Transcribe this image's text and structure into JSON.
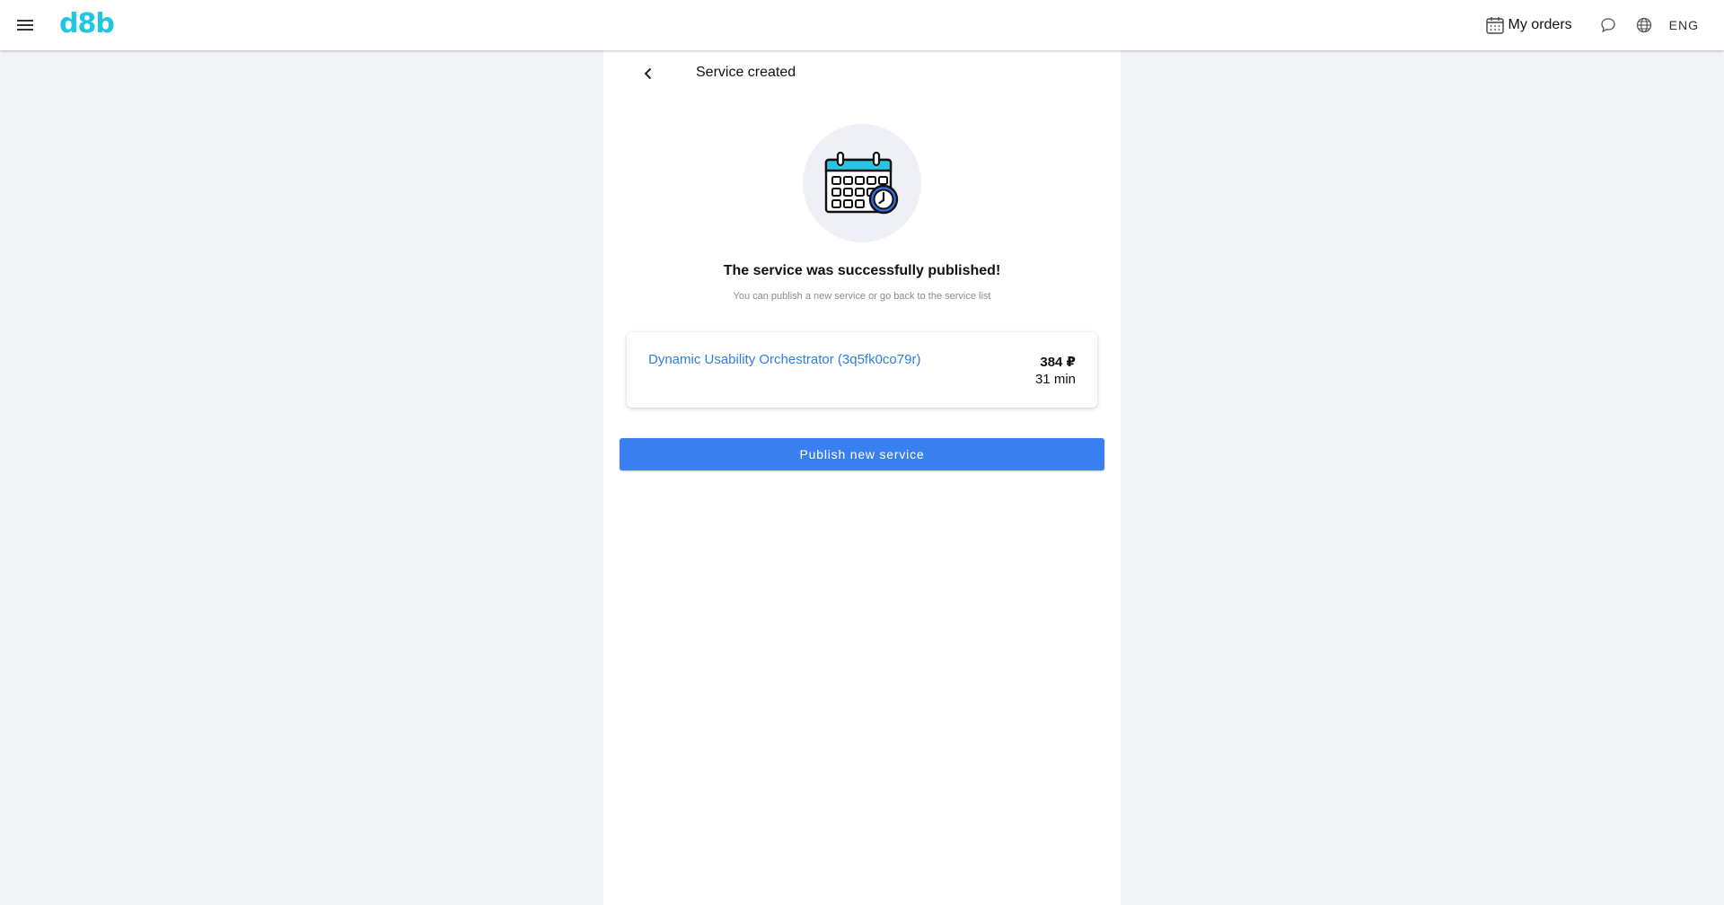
{
  "header": {
    "logo_text": "d8b",
    "orders_label": "My orders",
    "language": "ENG",
    "icons": {
      "menu": "menu-icon",
      "orders": "calendar-icon",
      "chat": "chat-bubble-icon",
      "language": "globe-icon"
    }
  },
  "page": {
    "title": "Service created",
    "success_title": "The service was successfully published!",
    "success_subtitle": "You can publish a new service or go back to the service list"
  },
  "service": {
    "name": "Dynamic Usability Orchestrator (3q5fk0co79r)",
    "price": "384 ₽",
    "duration": "31 min"
  },
  "actions": {
    "publish_new": "Publish new service"
  },
  "colors": {
    "brand": "#1ec8e0",
    "primary": "#3a7ff0",
    "link": "#2f7de1",
    "background": "#f3f4f7"
  }
}
